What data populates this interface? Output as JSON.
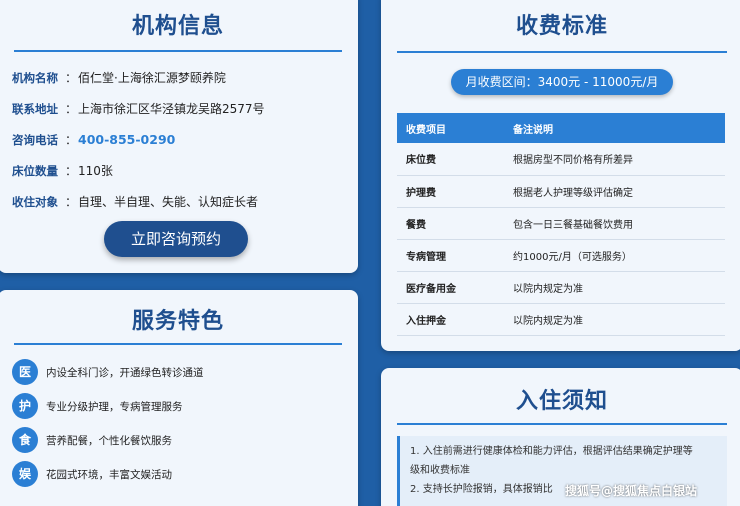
{
  "org": {
    "title": "机构信息",
    "sep": "：",
    "rows": [
      {
        "key": "机构名称",
        "value": "佰仁堂·上海徐汇源梦颐养院"
      },
      {
        "key": "联系地址",
        "value": "上海市徐汇区华泾镇龙吴路2577号"
      },
      {
        "key": "咨询电话",
        "value": "400-855-0290"
      },
      {
        "key": "床位数量",
        "value": "110张"
      },
      {
        "key": "收住对象",
        "value": "自理、半自理、失能、认知症长者"
      }
    ],
    "button_label": "立即咨询预约"
  },
  "service": {
    "title": "服务特色",
    "items": [
      {
        "icon": "医",
        "text": "内设全科门诊，开通绿色转诊通道"
      },
      {
        "icon": "护",
        "text": "专业分级护理，专病管理服务"
      },
      {
        "icon": "食",
        "text": "营养配餐，个性化餐饮服务"
      },
      {
        "icon": "娱",
        "text": "花园式环境，丰富文娱活动"
      }
    ]
  },
  "fee": {
    "title": "收费标准",
    "range": "月收费区间：3400元 - 11000元/月",
    "headers": [
      "收费项目",
      "备注说明"
    ],
    "rows": [
      {
        "item": "床位费",
        "note": "根据房型不同价格有所差异"
      },
      {
        "item": "护理费",
        "note": "根据老人护理等级评估确定"
      },
      {
        "item": "餐费",
        "note": "包含一日三餐基础餐饮费用"
      },
      {
        "item": "专病管理",
        "note": "约1000元/月（可选服务）"
      },
      {
        "item": "医疗备用金",
        "note": "以院内规定为准"
      },
      {
        "item": "入住押金",
        "note": "以院内规定为准"
      }
    ]
  },
  "notes": {
    "title": "入住须知",
    "lines": [
      "1. 入住前需进行健康体检和能力评估，根据评估结果确定护理等",
      "级和收费标准",
      "2. 支持长护险报销，具体报销比"
    ]
  },
  "watermark": "搜狐号@搜狐焦点白银站",
  "colors": {
    "accent": "#2b7fd4",
    "title": "#1f4f8f",
    "background": "#1f5fa6"
  }
}
